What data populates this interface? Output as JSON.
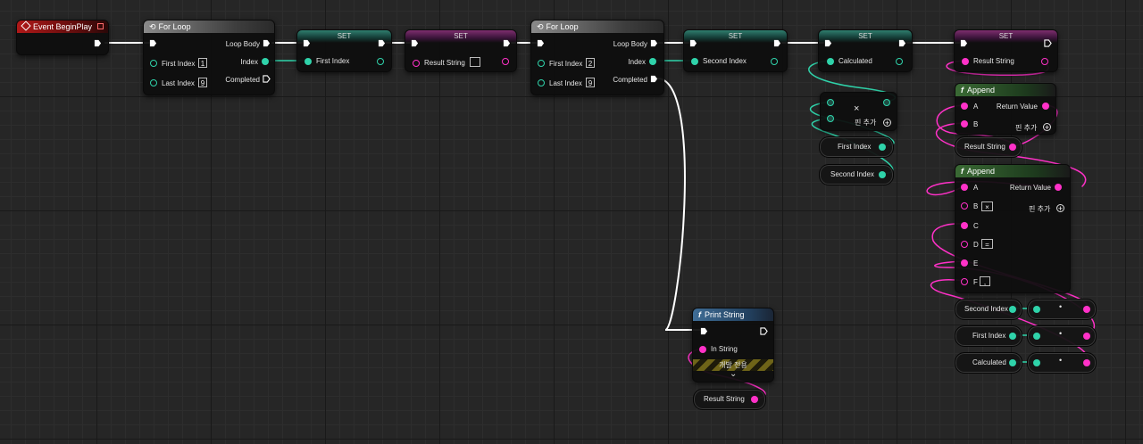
{
  "colors": {
    "exec": "#ffffff",
    "int_pin": "#2fd3aa",
    "string_pin": "#ff31c8",
    "event_header": "#b01818",
    "func_header": "#3a6a34",
    "print_header": "#3f6d96"
  },
  "event_begin_play": {
    "title": "Event BeginPlay"
  },
  "for_loop_1": {
    "title": "For Loop",
    "loop_body": "Loop Body",
    "first_index": "First Index",
    "first_index_value": "1",
    "index": "Index",
    "last_index": "Last Index",
    "last_index_value": "9",
    "completed": "Completed"
  },
  "set_first_index": {
    "title": "SET",
    "var": "First Index"
  },
  "set_result_string": {
    "title": "SET",
    "var": "Result String",
    "value": ""
  },
  "for_loop_2": {
    "title": "For Loop",
    "loop_body": "Loop Body",
    "first_index": "First Index",
    "first_index_value": "2",
    "index": "Index",
    "last_index": "Last Index",
    "last_index_value": "9",
    "completed": "Completed"
  },
  "set_second_index": {
    "title": "SET",
    "var": "Second Index"
  },
  "set_calculated": {
    "title": "SET",
    "var": "Calculated"
  },
  "set_result_string_2": {
    "title": "SET",
    "var": "Result String"
  },
  "multiply": {
    "symbol": "×",
    "add_pin": "핀 추가"
  },
  "get_first_index": {
    "label": "First Index"
  },
  "get_second_index": {
    "label": "Second Index"
  },
  "append_1": {
    "title": "Append",
    "a": "A",
    "b": "B",
    "return_value": "Return Value",
    "add_pin": "핀 추가"
  },
  "get_result_string_1": {
    "label": "Result String"
  },
  "append_2": {
    "title": "Append",
    "a": "A",
    "b": "B",
    "b_value": "×",
    "c": "C",
    "d": "D",
    "d_value": "=",
    "e": "E",
    "f": "F",
    "f_value": ",",
    "return_value": "Return Value",
    "add_pin": "핀 추가"
  },
  "conv_second_index": {
    "label": "Second Index"
  },
  "conv_first_index": {
    "label": "First Index"
  },
  "conv_calculated": {
    "label": "Calculated"
  },
  "print_string": {
    "title": "Print String",
    "in_string": "In String",
    "dev_only": "개발 전용"
  },
  "get_result_string_2": {
    "label": "Result String"
  },
  "icons": [
    "event-diamond-icon",
    "loop-icon",
    "function-icon",
    "exec-pin-icon",
    "add-pin-icon",
    "chevron-down-icon"
  ]
}
